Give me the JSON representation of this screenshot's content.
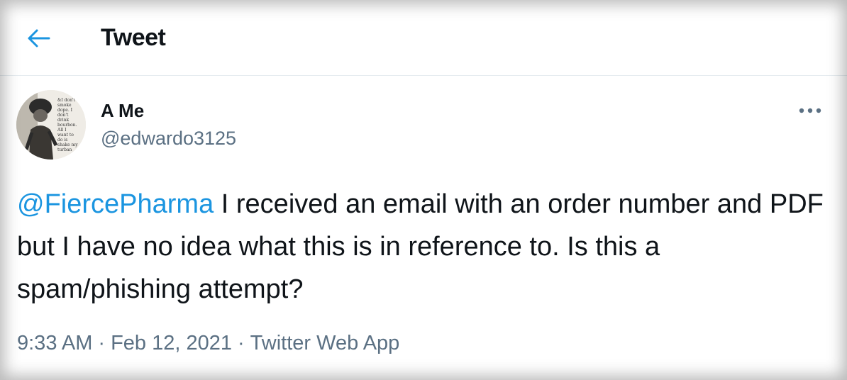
{
  "header": {
    "title": "Tweet",
    "back_icon": "arrow-left-icon",
    "accent_color": "#1b95e0"
  },
  "tweet": {
    "author": {
      "display_name": "A Me",
      "handle": "@edwardo3125",
      "avatar_caption_lines": [
        "&I don't",
        "smoke",
        "dope. I",
        "don't",
        "drink",
        "bourbon.",
        "All I",
        "want to",
        "do is",
        "shake my",
        "turban"
      ]
    },
    "more_icon": "more-horizontal-icon",
    "text": {
      "mention": "@FiercePharma",
      "body": " I received an email with an order number and PDF but I have no idea what this is in reference to. Is this a spam/phishing attempt?"
    },
    "meta": {
      "time": "9:33 AM",
      "separator": "·",
      "date": "Feb 12, 2021",
      "source": "Twitter Web App"
    }
  },
  "colors": {
    "text": "#0f1419",
    "secondary": "#5b7083",
    "link": "#1b95e0",
    "divider": "#e6ecf0"
  }
}
